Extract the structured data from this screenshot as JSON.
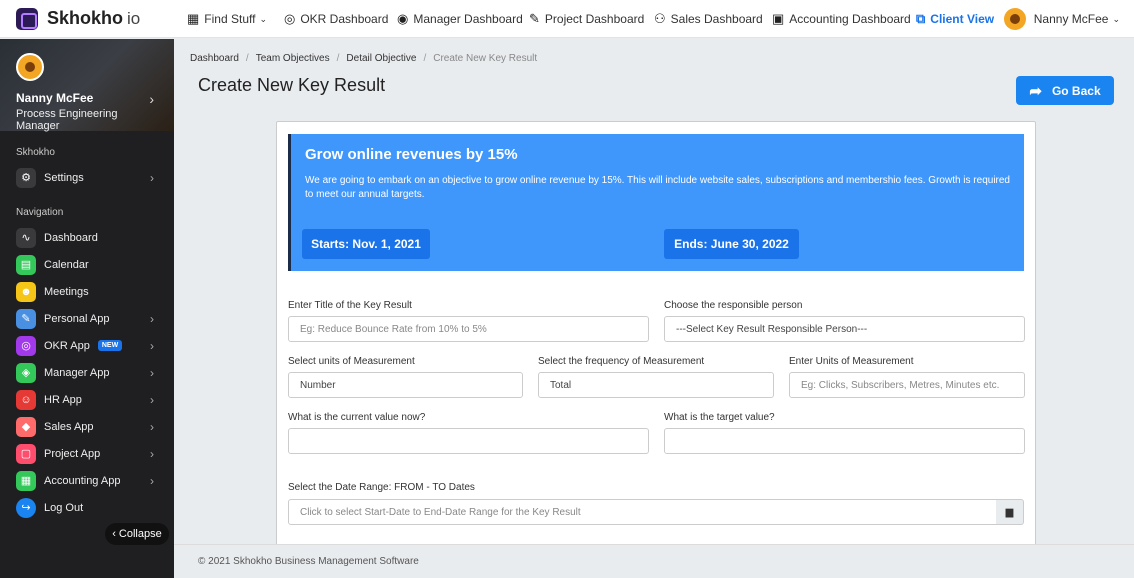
{
  "brand": {
    "name": "Skhokho",
    "suffix": "io"
  },
  "topnav": {
    "items": [
      {
        "label": "Find Stuff",
        "icon": "grid-icon"
      },
      {
        "label": "OKR Dashboard",
        "icon": "target-icon"
      },
      {
        "label": "Manager Dashboard",
        "icon": "user-circle-icon"
      },
      {
        "label": "Project Dashboard",
        "icon": "edit-icon"
      },
      {
        "label": "Sales Dashboard",
        "icon": "handshake-icon"
      },
      {
        "label": "Accounting Dashboard",
        "icon": "money-icon"
      },
      {
        "label": "Client View",
        "icon": "external-link-icon"
      }
    ],
    "user": "Nanny McFee"
  },
  "sidebar": {
    "profile": {
      "name": "Nanny McFee",
      "role": "Process Engineering Manager"
    },
    "section_app": "Skhokho",
    "settings_label": "Settings",
    "section_nav": "Navigation",
    "items": [
      {
        "label": "Dashboard",
        "icon": "pulse-icon",
        "color": "#3a3a3c"
      },
      {
        "label": "Calendar",
        "icon": "calendar-icon",
        "color": "#34c759"
      },
      {
        "label": "Meetings",
        "icon": "people-icon",
        "color": "#f5c518"
      },
      {
        "label": "Personal App",
        "icon": "notebook-icon",
        "color": "#4a90e2"
      },
      {
        "label": "OKR App",
        "icon": "target-icon",
        "color": "#a239ea",
        "badge": "NEW"
      },
      {
        "label": "Manager App",
        "icon": "layers-icon",
        "color": "#34c759"
      },
      {
        "label": "HR App",
        "icon": "person-badge-icon",
        "color": "#e53935"
      },
      {
        "label": "Sales App",
        "icon": "tag-icon",
        "color": "#ff6b6b"
      },
      {
        "label": "Project App",
        "icon": "project-icon",
        "color": "#ff4d6d"
      },
      {
        "label": "Accounting App",
        "icon": "calculator-icon",
        "color": "#34c759"
      },
      {
        "label": "Log Out",
        "icon": "logout-icon",
        "color": "#1a84f0"
      }
    ],
    "collapse_label": "Collapse"
  },
  "breadcrumb": [
    "Dashboard",
    "Team Objectives",
    "Detail Objective",
    "Create New Key Result"
  ],
  "page_title": "Create New Key Result",
  "go_back_label": "Go Back",
  "objective": {
    "title": "Grow online revenues by 15%",
    "description": "We are going to embark on an objective to grow online revenue by 15%. This will include website sales, subscriptions and membershio fees. Growth is required to meet our annual targets.",
    "starts": "Starts: Nov. 1, 2021",
    "ends": "Ends: June 30, 2022"
  },
  "form": {
    "title_label": "Enter Title of the Key Result",
    "title_placeholder": "Eg: Reduce Bounce Rate from 10% to 5%",
    "person_label": "Choose the responsible person",
    "person_value": "---Select Key Result Responsible Person---",
    "units_label": "Select units of Measurement",
    "units_value": "Number",
    "frequency_label": "Select the frequency of Measurement",
    "frequency_value": "Total",
    "enter_units_label": "Enter Units of Measurement",
    "enter_units_placeholder": "Eg: Clicks, Subscribers, Metres, Minutes etc.",
    "current_label": "What is the current value now?",
    "current_value": "",
    "target_label": "What is the target value?",
    "target_value": "",
    "date_label": "Select the Date Range: FROM - TO Dates",
    "date_placeholder": "Click to select Start-Date to End-Date Range for the Key Result"
  },
  "footer": "© 2021 Skhokho Business Management Software"
}
